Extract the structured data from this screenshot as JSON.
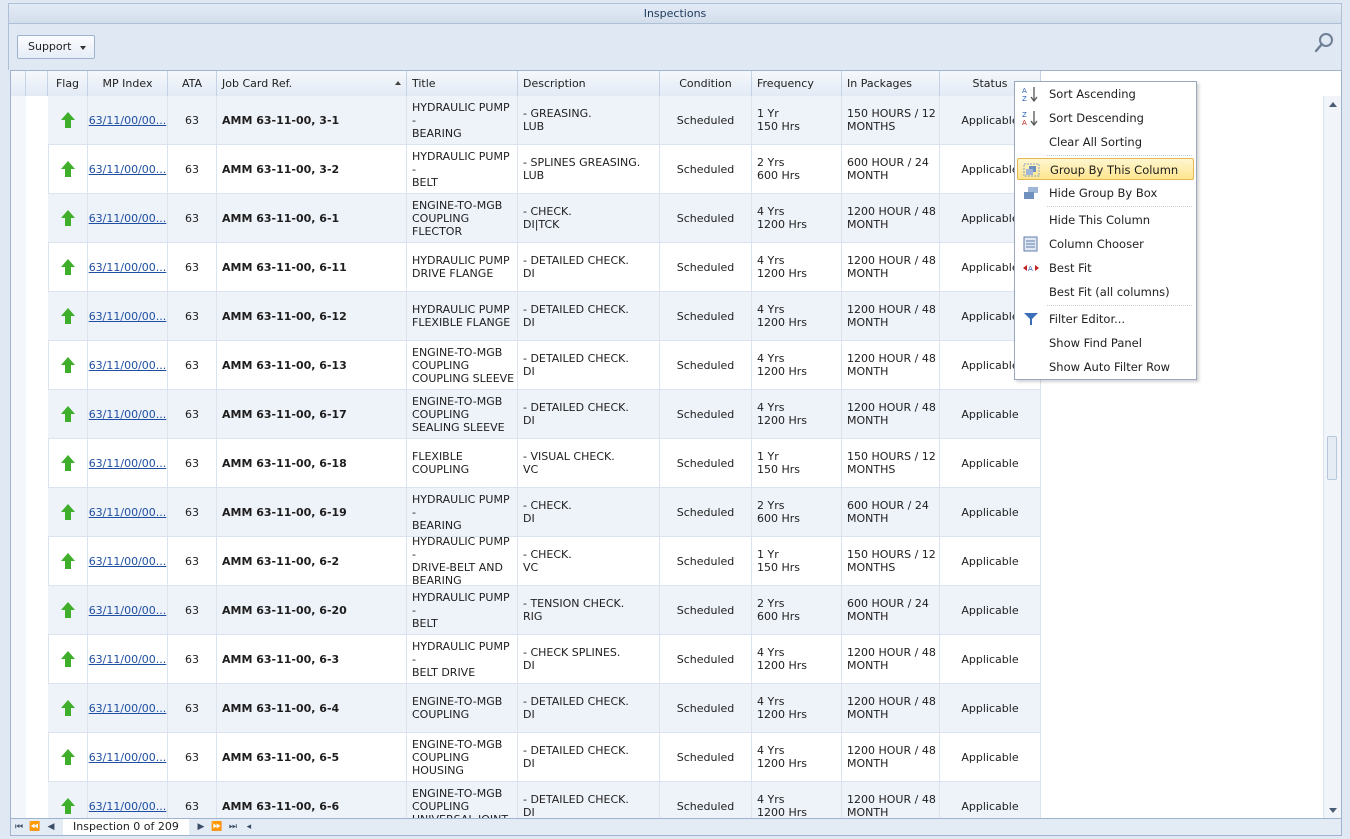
{
  "window": {
    "title": "Inspections"
  },
  "toolbar": {
    "support_label": "Support"
  },
  "columns": [
    "Flag",
    "MP Index",
    "ATA",
    "Job Card Ref.",
    "Title",
    "Description",
    "Condition",
    "Frequency",
    "In Packages",
    "Status"
  ],
  "rows": [
    {
      "mp": "63/11/00/00...",
      "ata": "63",
      "job": "AMM 63-11-00, 3-1",
      "title": "HYDRAULIC PUMP -\nBEARING",
      "desc": "- GREASING.\nLUB",
      "cond": "Scheduled",
      "freq": "1 Yr\n150 Hrs",
      "pkg": "150 HOURS / 12\nMONTHS",
      "status": "Applicable"
    },
    {
      "mp": "63/11/00/00...",
      "ata": "63",
      "job": "AMM 63-11-00, 3-2",
      "title": "HYDRAULIC PUMP -\nBELT",
      "desc": "- SPLINES GREASING.\nLUB",
      "cond": "Scheduled",
      "freq": "2 Yrs\n600 Hrs",
      "pkg": "600 HOUR / 24\nMONTH",
      "status": "Applicable"
    },
    {
      "mp": "63/11/00/00...",
      "ata": "63",
      "job": "AMM 63-11-00, 6-1",
      "title": "ENGINE-TO-MGB\nCOUPLING\nFLECTOR",
      "desc": "- CHECK.\nDI|TCK",
      "cond": "Scheduled",
      "freq": "4 Yrs\n1200 Hrs",
      "pkg": "1200 HOUR / 48\nMONTH",
      "status": "Applicable"
    },
    {
      "mp": "63/11/00/00...",
      "ata": "63",
      "job": "AMM 63-11-00, 6-11",
      "title": "HYDRAULIC PUMP\nDRIVE FLANGE",
      "desc": "- DETAILED CHECK.\nDI",
      "cond": "Scheduled",
      "freq": "4 Yrs\n1200 Hrs",
      "pkg": "1200 HOUR / 48\nMONTH",
      "status": "Applicable"
    },
    {
      "mp": "63/11/00/00...",
      "ata": "63",
      "job": "AMM 63-11-00, 6-12",
      "title": "HYDRAULIC PUMP\nFLEXIBLE FLANGE",
      "desc": "- DETAILED CHECK.\nDI",
      "cond": "Scheduled",
      "freq": "4 Yrs\n1200 Hrs",
      "pkg": "1200 HOUR / 48\nMONTH",
      "status": "Applicable"
    },
    {
      "mp": "63/11/00/00...",
      "ata": "63",
      "job": "AMM 63-11-00, 6-13",
      "title": "ENGINE-TO-MGB\nCOUPLING\nCOUPLING SLEEVE",
      "desc": "- DETAILED CHECK.\nDI",
      "cond": "Scheduled",
      "freq": "4 Yrs\n1200 Hrs",
      "pkg": "1200 HOUR / 48\nMONTH",
      "status": "Applicable"
    },
    {
      "mp": "63/11/00/00...",
      "ata": "63",
      "job": "AMM 63-11-00, 6-17",
      "title": "ENGINE-TO-MGB\nCOUPLING\nSEALING SLEEVE",
      "desc": "- DETAILED CHECK.\nDI",
      "cond": "Scheduled",
      "freq": "4 Yrs\n1200 Hrs",
      "pkg": "1200 HOUR / 48\nMONTH",
      "status": "Applicable"
    },
    {
      "mp": "63/11/00/00...",
      "ata": "63",
      "job": "AMM 63-11-00, 6-18",
      "title": "FLEXIBLE COUPLING",
      "desc": "- VISUAL CHECK.\nVC",
      "cond": "Scheduled",
      "freq": "1 Yr\n150 Hrs",
      "pkg": "150 HOURS / 12\nMONTHS",
      "status": "Applicable"
    },
    {
      "mp": "63/11/00/00...",
      "ata": "63",
      "job": "AMM 63-11-00, 6-19",
      "title": "HYDRAULIC PUMP -\nBEARING",
      "desc": "- CHECK.\nDI",
      "cond": "Scheduled",
      "freq": "2 Yrs\n600 Hrs",
      "pkg": "600 HOUR / 24\nMONTH",
      "status": "Applicable"
    },
    {
      "mp": "63/11/00/00...",
      "ata": "63",
      "job": "AMM 63-11-00, 6-2",
      "title": "HYDRAULIC PUMP -\nDRIVE-BELT AND\nBEARING",
      "desc": "- CHECK.\nVC",
      "cond": "Scheduled",
      "freq": "1 Yr\n150 Hrs",
      "pkg": "150 HOURS / 12\nMONTHS",
      "status": "Applicable"
    },
    {
      "mp": "63/11/00/00...",
      "ata": "63",
      "job": "AMM 63-11-00, 6-20",
      "title": "HYDRAULIC PUMP -\nBELT",
      "desc": "- TENSION CHECK.\nRIG",
      "cond": "Scheduled",
      "freq": "2 Yrs\n600 Hrs",
      "pkg": "600 HOUR / 24\nMONTH",
      "status": "Applicable"
    },
    {
      "mp": "63/11/00/00...",
      "ata": "63",
      "job": "AMM 63-11-00, 6-3",
      "title": "HYDRAULIC PUMP -\nBELT DRIVE",
      "desc": "- CHECK SPLINES.\nDI",
      "cond": "Scheduled",
      "freq": "4 Yrs\n1200 Hrs",
      "pkg": "1200 HOUR / 48\nMONTH",
      "status": "Applicable"
    },
    {
      "mp": "63/11/00/00...",
      "ata": "63",
      "job": "AMM 63-11-00, 6-4",
      "title": "ENGINE-TO-MGB\nCOUPLING",
      "desc": "- DETAILED CHECK.\nDI",
      "cond": "Scheduled",
      "freq": "4 Yrs\n1200 Hrs",
      "pkg": "1200 HOUR / 48\nMONTH",
      "status": "Applicable"
    },
    {
      "mp": "63/11/00/00...",
      "ata": "63",
      "job": "AMM 63-11-00, 6-5",
      "title": "ENGINE-TO-MGB\nCOUPLING\nHOUSING",
      "desc": "- DETAILED CHECK.\nDI",
      "cond": "Scheduled",
      "freq": "4 Yrs\n1200 Hrs",
      "pkg": "1200 HOUR / 48\nMONTH",
      "status": "Applicable"
    },
    {
      "mp": "63/11/00/00...",
      "ata": "63",
      "job": "AMM 63-11-00, 6-6",
      "title": "ENGINE-TO-MGB\nCOUPLING\nUNIVERSAL JOINT",
      "desc": "- DETAILED CHECK.\nDI",
      "cond": "Scheduled",
      "freq": "4 Yrs\n1200 Hrs",
      "pkg": "1200 HOUR / 48\nMONTH",
      "status": "Applicable"
    }
  ],
  "context_menu": {
    "items": [
      {
        "label": "Sort Ascending",
        "icon": "sort-ascending-icon"
      },
      {
        "label": "Sort Descending",
        "icon": "sort-descending-icon"
      },
      {
        "label": "Clear All Sorting",
        "icon": ""
      },
      {
        "label": "Group By This Column",
        "icon": "group-by-column-icon",
        "highlighted": true
      },
      {
        "label": "Hide Group By Box",
        "icon": "group-box-icon"
      },
      {
        "label": "Hide This Column",
        "icon": ""
      },
      {
        "label": "Column Chooser",
        "icon": "column-chooser-icon"
      },
      {
        "label": "Best Fit",
        "icon": "best-fit-icon"
      },
      {
        "label": "Best Fit (all columns)",
        "icon": ""
      },
      {
        "label": "Filter Editor...",
        "icon": "filter-icon"
      },
      {
        "label": "Show Find Panel",
        "icon": ""
      },
      {
        "label": "Show Auto Filter Row",
        "icon": ""
      }
    ]
  },
  "navigator": {
    "record_text": "Inspection 0 of 209"
  },
  "colors": {
    "flag_green": "#3fae2a",
    "link_blue": "#1f4fa3",
    "menu_highlight": "#fde58f"
  }
}
